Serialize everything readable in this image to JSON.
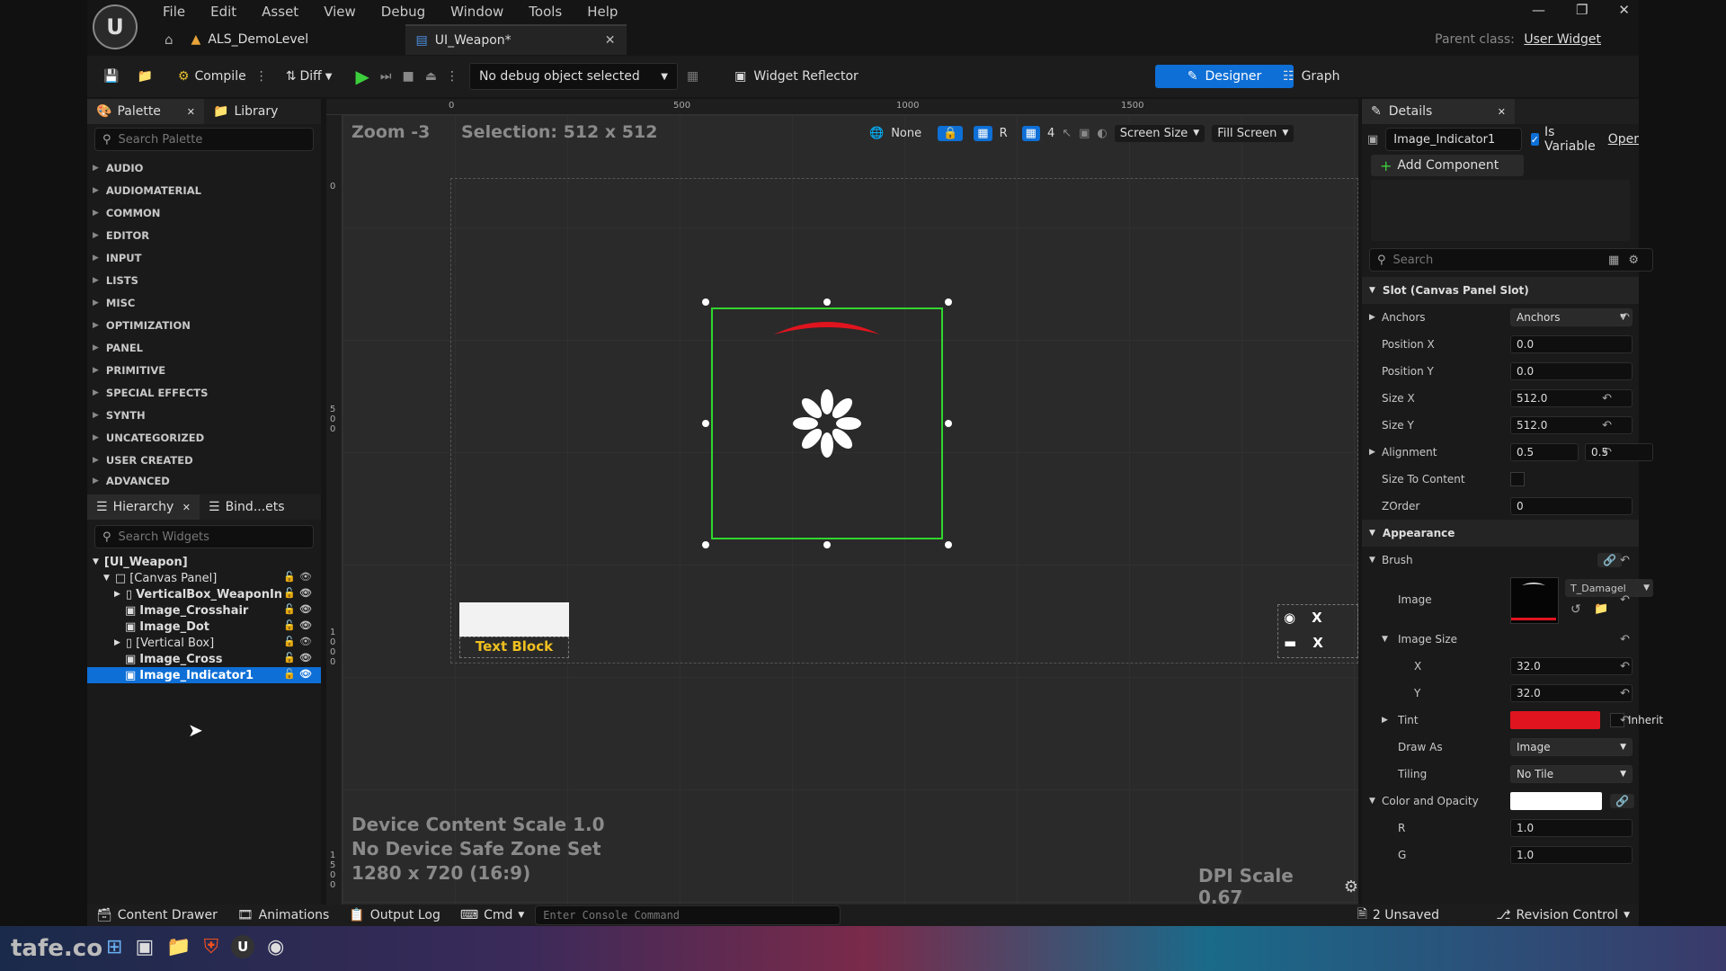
{
  "menu": {
    "items": [
      "File",
      "Edit",
      "Asset",
      "View",
      "Debug",
      "Window",
      "Tools",
      "Help"
    ],
    "logo": "U"
  },
  "tabs": {
    "level_tab": "ALS_DemoLevel",
    "widget_tab": "UI_Weapon*",
    "parent_class_label": "Parent class:",
    "parent_class_value": "User Widget"
  },
  "toolbar": {
    "compile": "Compile",
    "diff": "Diff",
    "debug_object": "No debug object selected",
    "widget_reflector": "Widget Reflector",
    "designer": "Designer",
    "graph": "Graph"
  },
  "palette": {
    "tab_palette": "Palette",
    "tab_library": "Library",
    "search_placeholder": "Search Palette",
    "categories": [
      "AUDIO",
      "AUDIOMATERIAL",
      "COMMON",
      "EDITOR",
      "INPUT",
      "LISTS",
      "MISC",
      "OPTIMIZATION",
      "PANEL",
      "PRIMITIVE",
      "SPECIAL EFFECTS",
      "SYNTH",
      "UNCATEGORIZED",
      "USER CREATED",
      "ADVANCED"
    ]
  },
  "hierarchy": {
    "tab_hierarchy": "Hierarchy",
    "tab_bind": "Bind...ets",
    "search_placeholder": "Search Widgets",
    "root": "[UI_Weapon]",
    "canvas": "[Canvas Panel]",
    "items": [
      "VerticalBox_WeaponIn",
      "Image_Crosshair",
      "Image_Dot",
      "[Vertical Box]",
      "Image_Cross",
      "Image_Indicator1"
    ]
  },
  "viewport": {
    "zoom": "Zoom -3",
    "selection": "Selection: 512 x 512",
    "none_label": "None",
    "r_label": "R",
    "grid_num": "4",
    "screen_size": "Screen Size",
    "fill_screen": "Fill Screen",
    "ruler_ticks": [
      "0",
      "500",
      "1000",
      "1500"
    ],
    "ruler_v": [
      "0",
      "5 0 0",
      "1 0 0 0",
      "1 5 0 0"
    ],
    "text_block": "Text Block",
    "x1": "X",
    "x2": "X",
    "device_scale": "Device Content Scale 1.0",
    "safe_zone": "No Device Safe Zone Set",
    "resolution": "1280 x 720 (16:9)",
    "dpi": "DPI Scale 0.67",
    "indicator_color": "#e0141e",
    "selection_color": "#31d62e"
  },
  "details": {
    "title": "Details",
    "widget_name": "Image_Indicator1",
    "is_variable": "Is Variable",
    "open": "Oper",
    "add_component": "Add Component",
    "search_placeholder": "Search",
    "slot_header": "Slot (Canvas Panel Slot)",
    "anchors_label": "Anchors",
    "anchors_value": "Anchors",
    "position_x_label": "Position X",
    "position_x": "0.0",
    "position_y_label": "Position Y",
    "position_y": "0.0",
    "size_x_label": "Size X",
    "size_x": "512.0",
    "size_y_label": "Size Y",
    "size_y": "512.0",
    "alignment_label": "Alignment",
    "alignment_x": "0.5",
    "alignment_y": "0.5",
    "size_to_content_label": "Size To Content",
    "zorder_label": "ZOrder",
    "zorder": "0",
    "appearance_header": "Appearance",
    "brush_label": "Brush",
    "image_label": "Image",
    "image_asset": "T_Damagel",
    "image_size_label": "Image Size",
    "image_size_x_label": "X",
    "image_size_x": "32.0",
    "image_size_y_label": "Y",
    "image_size_y": "32.0",
    "tint_label": "Tint",
    "tint_color": "#e0141e",
    "inherit": "Inherit",
    "draw_as_label": "Draw As",
    "draw_as": "Image",
    "tiling_label": "Tiling",
    "tiling": "No Tile",
    "color_opacity_label": "Color and Opacity",
    "r_label": "R",
    "r_value": "1.0",
    "g_label": "G",
    "g_value": "1.0"
  },
  "bottom": {
    "content_drawer": "Content Drawer",
    "animations": "Animations",
    "output_log": "Output Log",
    "cmd": "Cmd",
    "console_placeholder": "Enter Console Command",
    "unsaved": "2 Unsaved",
    "revision_control": "Revision Control"
  },
  "taskbar": {
    "watermark": "tafe.co"
  }
}
